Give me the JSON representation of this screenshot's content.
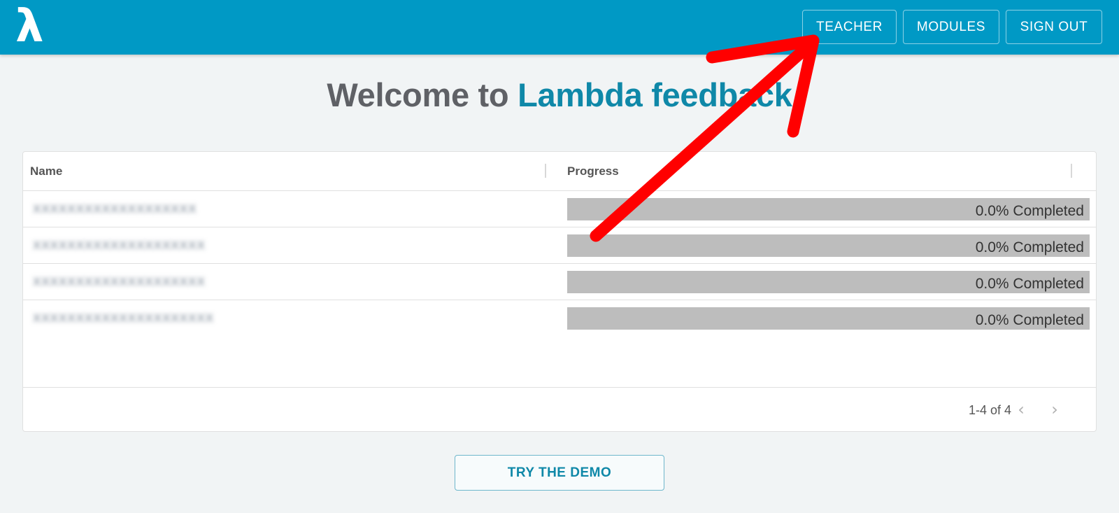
{
  "app": {
    "logo_symbol": "λ",
    "brand_color": "#0099c5"
  },
  "nav": {
    "teacher": "TEACHER",
    "modules": "MODULES",
    "sign_out": "SIGN OUT"
  },
  "welcome": {
    "prefix": "Welcome to ",
    "brand": "Lambda feedback"
  },
  "table": {
    "columns": {
      "name": "Name",
      "progress": "Progress"
    },
    "rows": [
      {
        "name": "XXXXXXXXXXXXXXXXXXX",
        "progress_fraction": 0.0,
        "progress_label": "0.0% Completed"
      },
      {
        "name": "XXXXXXXXXXXXXXXXXXXX",
        "progress_fraction": 0.0,
        "progress_label": "0.0% Completed"
      },
      {
        "name": "XXXXXXXXXXXXXXXXXXXX",
        "progress_fraction": 0.0,
        "progress_label": "0.0% Completed"
      },
      {
        "name": "XXXXXXXXXXXXXXXXXXXXX",
        "progress_fraction": 0.0,
        "progress_label": "0.0% Completed"
      }
    ],
    "pagination": {
      "range": "1-4 of 4",
      "prev_icon": "chevron-left-icon",
      "next_icon": "chevron-right-icon"
    }
  },
  "demo_button": "TRY THE DEMO",
  "annotation": {
    "type": "arrow",
    "color": "#ff0000"
  }
}
